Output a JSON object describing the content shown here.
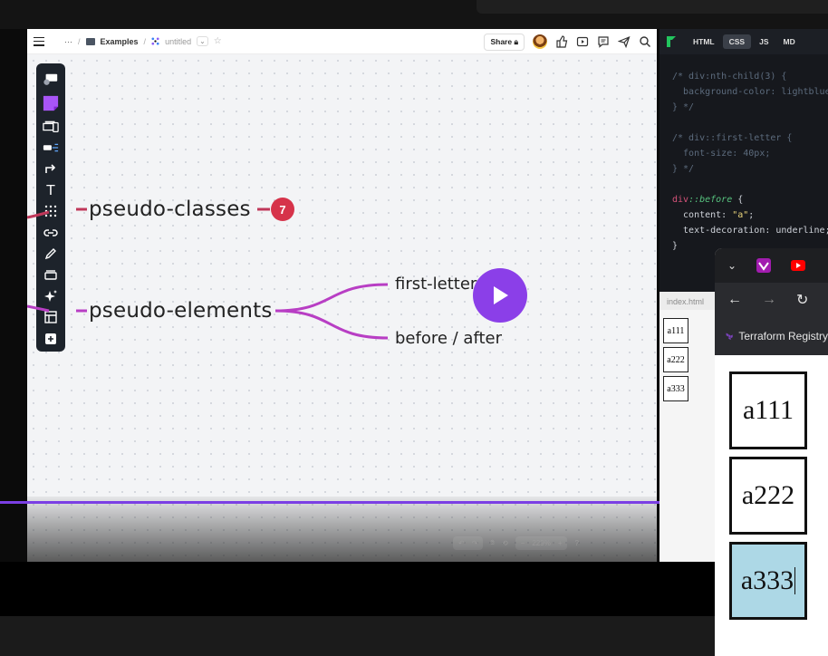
{
  "board": {
    "breadcrumb_more": "···",
    "breadcrumb_folder": "Examples",
    "breadcrumb_doc": "untitled",
    "share_label": "Share",
    "nodes": {
      "pseudo_classes": "pseudo-classes",
      "pseudo_classes_count": "7",
      "pseudo_elements": "pseudo-elements",
      "first_letter": "first-letter",
      "before_after": "before / after"
    },
    "zoom_level": "229%",
    "help": "?",
    "colors": {
      "accent": "#8b3fe8",
      "branch": "#c03fc6",
      "badge": "#d6334a"
    }
  },
  "editor": {
    "tabs": [
      "HTML",
      "CSS",
      "JS",
      "MD"
    ],
    "active_tab": "CSS",
    "lines": {
      "l1": "/* div:nth-child(3) {",
      "l2": "  background-color: lightblue;",
      "l3": "} */",
      "l4": "/* div::first-letter {",
      "l5": "  font-size: 40px;",
      "l6": "} */",
      "sel_div": "div",
      "sel_pseudo": "::before",
      "sel_brace": " {",
      "l8_prop": "  content: ",
      "l8_val": "\"a\"",
      "l8_end": ";",
      "l9": "  text-decoration: underline;",
      "l10": "}"
    }
  },
  "preview": {
    "file_tab": "index.html",
    "boxes": [
      "a111",
      "a222",
      "a333"
    ]
  },
  "browser": {
    "bookmark": "Terraform Registry",
    "boxes": [
      "a111",
      "a222",
      "a333"
    ],
    "highlight_color": "#add8e6"
  }
}
